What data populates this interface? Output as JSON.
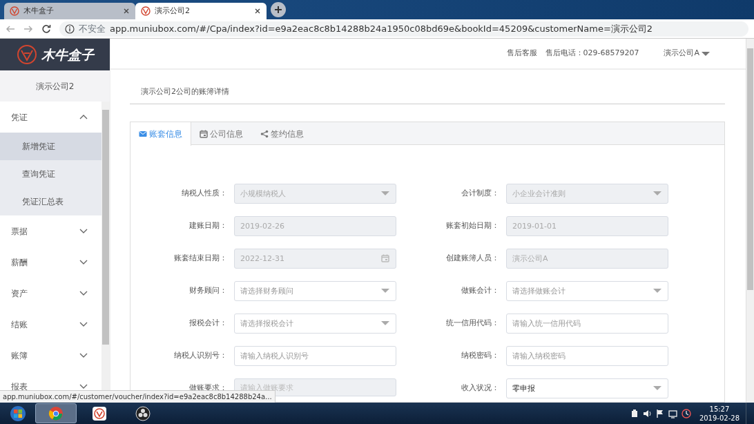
{
  "browser": {
    "tabs": [
      {
        "title": "木牛盒子",
        "selected": false
      },
      {
        "title": "演示公司2",
        "selected": true
      }
    ],
    "security": "不安全",
    "url": "app.muniubox.com/#/Cpa/index?id=e9a2eac8c8b14288b24a1950c08bd69e&bookId=45209&customerName=演示公司2",
    "status_url": "app.muniubox.com/#/customer/voucher/index?id=e9a2eac8c8b14288b24a..."
  },
  "logo": "木牛盒子",
  "sidebar": {
    "company": "演示公司2",
    "items": [
      {
        "label": "凭证",
        "expanded": true,
        "children": [
          {
            "label": "新增凭证",
            "selected": true
          },
          {
            "label": "查询凭证",
            "selected": false
          },
          {
            "label": "凭证汇总表",
            "selected": false
          }
        ]
      },
      {
        "label": "票据",
        "expanded": false
      },
      {
        "label": "薪酬",
        "expanded": false
      },
      {
        "label": "资产",
        "expanded": false
      },
      {
        "label": "结账",
        "expanded": false
      },
      {
        "label": "账簿",
        "expanded": false
      },
      {
        "label": "报表",
        "expanded": false
      }
    ]
  },
  "header": {
    "service": "售后客服",
    "phone": "售后电话：029-68579207",
    "user": "演示公司A"
  },
  "page_title": "演示公司2公司的账簿详情",
  "tabs": [
    {
      "label": "账套信息",
      "selected": true
    },
    {
      "label": "公司信息",
      "selected": false
    },
    {
      "label": "签约信息",
      "selected": false
    }
  ],
  "fields": [
    {
      "label": "纳税人性质：",
      "kind": "select",
      "value": "小规模纳税人",
      "disabled": true
    },
    {
      "label": "会计制度：",
      "kind": "select",
      "value": "小企业会计准则",
      "disabled": true
    },
    {
      "label": "建账日期：",
      "kind": "text",
      "value": "2019-02-26",
      "disabled": true
    },
    {
      "label": "账套初始日期：",
      "kind": "text",
      "value": "2019-01-01",
      "disabled": true
    },
    {
      "label": "账套结束日期：",
      "kind": "date",
      "value": "2022-12-31",
      "disabled": true
    },
    {
      "label": "创建账簿人员：",
      "kind": "text",
      "value": "演示公司A",
      "disabled": true
    },
    {
      "label": "财务顾问：",
      "kind": "select",
      "placeholder": "请选择财务顾问",
      "disabled": false
    },
    {
      "label": "做账会计：",
      "kind": "select",
      "placeholder": "请选择做账会计",
      "disabled": false
    },
    {
      "label": "报税会计：",
      "kind": "select",
      "placeholder": "请选择报税会计",
      "disabled": false
    },
    {
      "label": "统一信用代码：",
      "kind": "text",
      "placeholder": "请输入统一信用代码",
      "disabled": false
    },
    {
      "label": "纳税人识别号：",
      "kind": "text",
      "placeholder": "请输入纳税人识别号",
      "disabled": false
    },
    {
      "label": "纳税密码：",
      "kind": "text",
      "placeholder": "请输入纳税密码",
      "disabled": false
    },
    {
      "label": "做账要求：",
      "kind": "textarea",
      "placeholder": "请输入做账要求",
      "disabled": true
    },
    {
      "label": "收入状况：",
      "kind": "select",
      "value": "零申报",
      "disabled": false
    }
  ],
  "taskbar": {
    "apps": [
      {
        "selected": true
      },
      {
        "selected": false
      },
      {
        "selected": false
      }
    ],
    "time": "15:27",
    "date": "2019-02-28"
  }
}
